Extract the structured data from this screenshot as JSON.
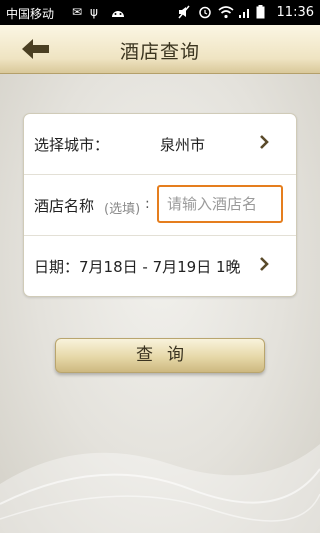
{
  "status_bar": {
    "carrier": "中国移动",
    "time": "11:36"
  },
  "header": {
    "title": "酒店查询",
    "back_icon": "back-arrow-icon"
  },
  "form": {
    "city": {
      "label": "选择城市：",
      "value": "泉州市"
    },
    "hotel": {
      "label": "酒店名称",
      "optional_hint": "(选填)",
      "colon": ":",
      "placeholder": "请输入酒店名"
    },
    "date": {
      "label": "日期：7月18日 - 7月19日  1晚"
    }
  },
  "query_button": {
    "label": "查询"
  },
  "colors": {
    "accent_orange": "#e57e1e",
    "gold": "#e6d8a8",
    "chevron": "#5a4a2a"
  }
}
